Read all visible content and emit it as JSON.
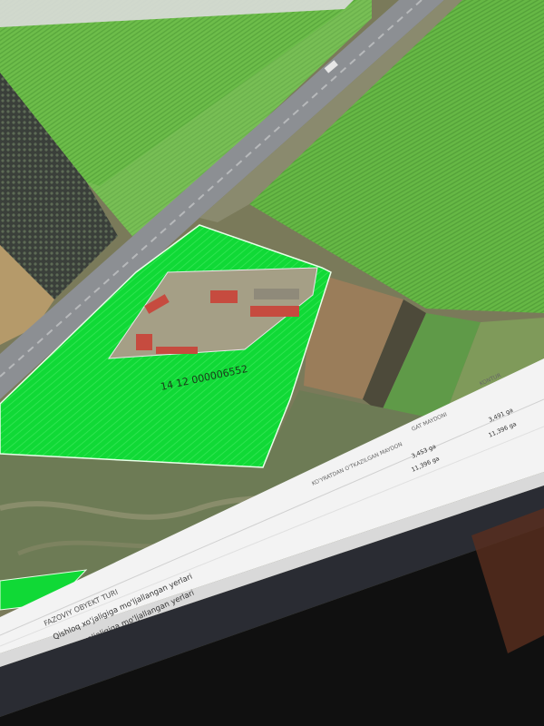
{
  "map": {
    "parcel_id": "14 12 000006552"
  },
  "table": {
    "headers": {
      "type": "FAZOVIY OBYEKT TURI",
      "area_doc": "KO'YRATDAN O'TKAZILGAN MAYDON",
      "area_real": "GAT MAYDONI",
      "contour": "KONTUR"
    },
    "rows": [
      {
        "type": "Qishloq xo'jaligiga mo'ljallangan yerlari",
        "area_doc": "3,453 ga",
        "area_real": "3,491 ga"
      },
      {
        "type": "Qishloq xo'jaligiga mo'ljallangan yerlari",
        "area_doc": "11,396 ga",
        "area_real": "11,396 ga"
      }
    ]
  },
  "taskbar": {
    "icons": [
      "windows-start-icon",
      "app-icon",
      "browser-icon"
    ]
  },
  "colors": {
    "parcel_fill": "#10d936",
    "field_green": "#6dbd4a",
    "road": "#8c8f93",
    "panel_bg": "#f3f3f3",
    "bezel": "#101010"
  }
}
